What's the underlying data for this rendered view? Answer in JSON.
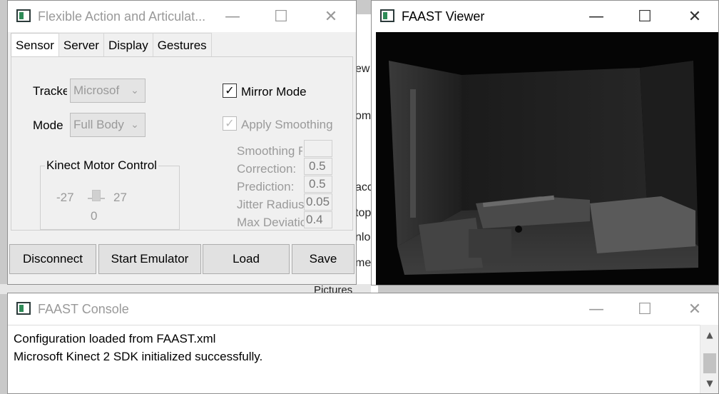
{
  "main_window": {
    "title": "Flexible Action and Articulat...",
    "tabs": [
      {
        "label": "Sensor"
      },
      {
        "label": "Server"
      },
      {
        "label": "Display"
      },
      {
        "label": "Gestures"
      }
    ],
    "sensor": {
      "tracker_label": "Tracke",
      "tracker_value": "Microsof",
      "mode_label": "Mode",
      "mode_value": "Full Body",
      "mirror_mode_label": "Mirror Mode",
      "mirror_mode_checked": true,
      "apply_smoothing_label": "Apply Smoothing",
      "apply_smoothing_checked": true,
      "motor_group_title": "Kinect Motor Control",
      "motor_min": "-27",
      "motor_max": "27",
      "motor_value": "0",
      "smoothing": [
        {
          "label": "Smoothing Factor:",
          "value": ""
        },
        {
          "label": "Correction:",
          "value": "0.5"
        },
        {
          "label": "Prediction:",
          "value": "0.5"
        },
        {
          "label": "Jitter Radius:",
          "value": "0.05"
        },
        {
          "label": "Max Deviation:",
          "value": "0.4"
        }
      ]
    },
    "buttons": {
      "disconnect": "Disconnect",
      "start_emulator": "Start Emulator",
      "load": "Load",
      "save": "Save"
    }
  },
  "viewer_window": {
    "title": "FAAST Viewer"
  },
  "console_window": {
    "title": "FAAST Console",
    "lines": [
      "Configuration loaded from FAAST.xml",
      "Microsoft Kinect 2 SDK initialized successfully."
    ]
  },
  "background": {
    "fragments": [
      "ew",
      "om",
      "acc",
      "top",
      "nlo",
      "me",
      "Pictures"
    ]
  },
  "icons": {
    "minimize": "minimize-icon",
    "maximize": "maximize-icon",
    "close": "close-icon"
  }
}
